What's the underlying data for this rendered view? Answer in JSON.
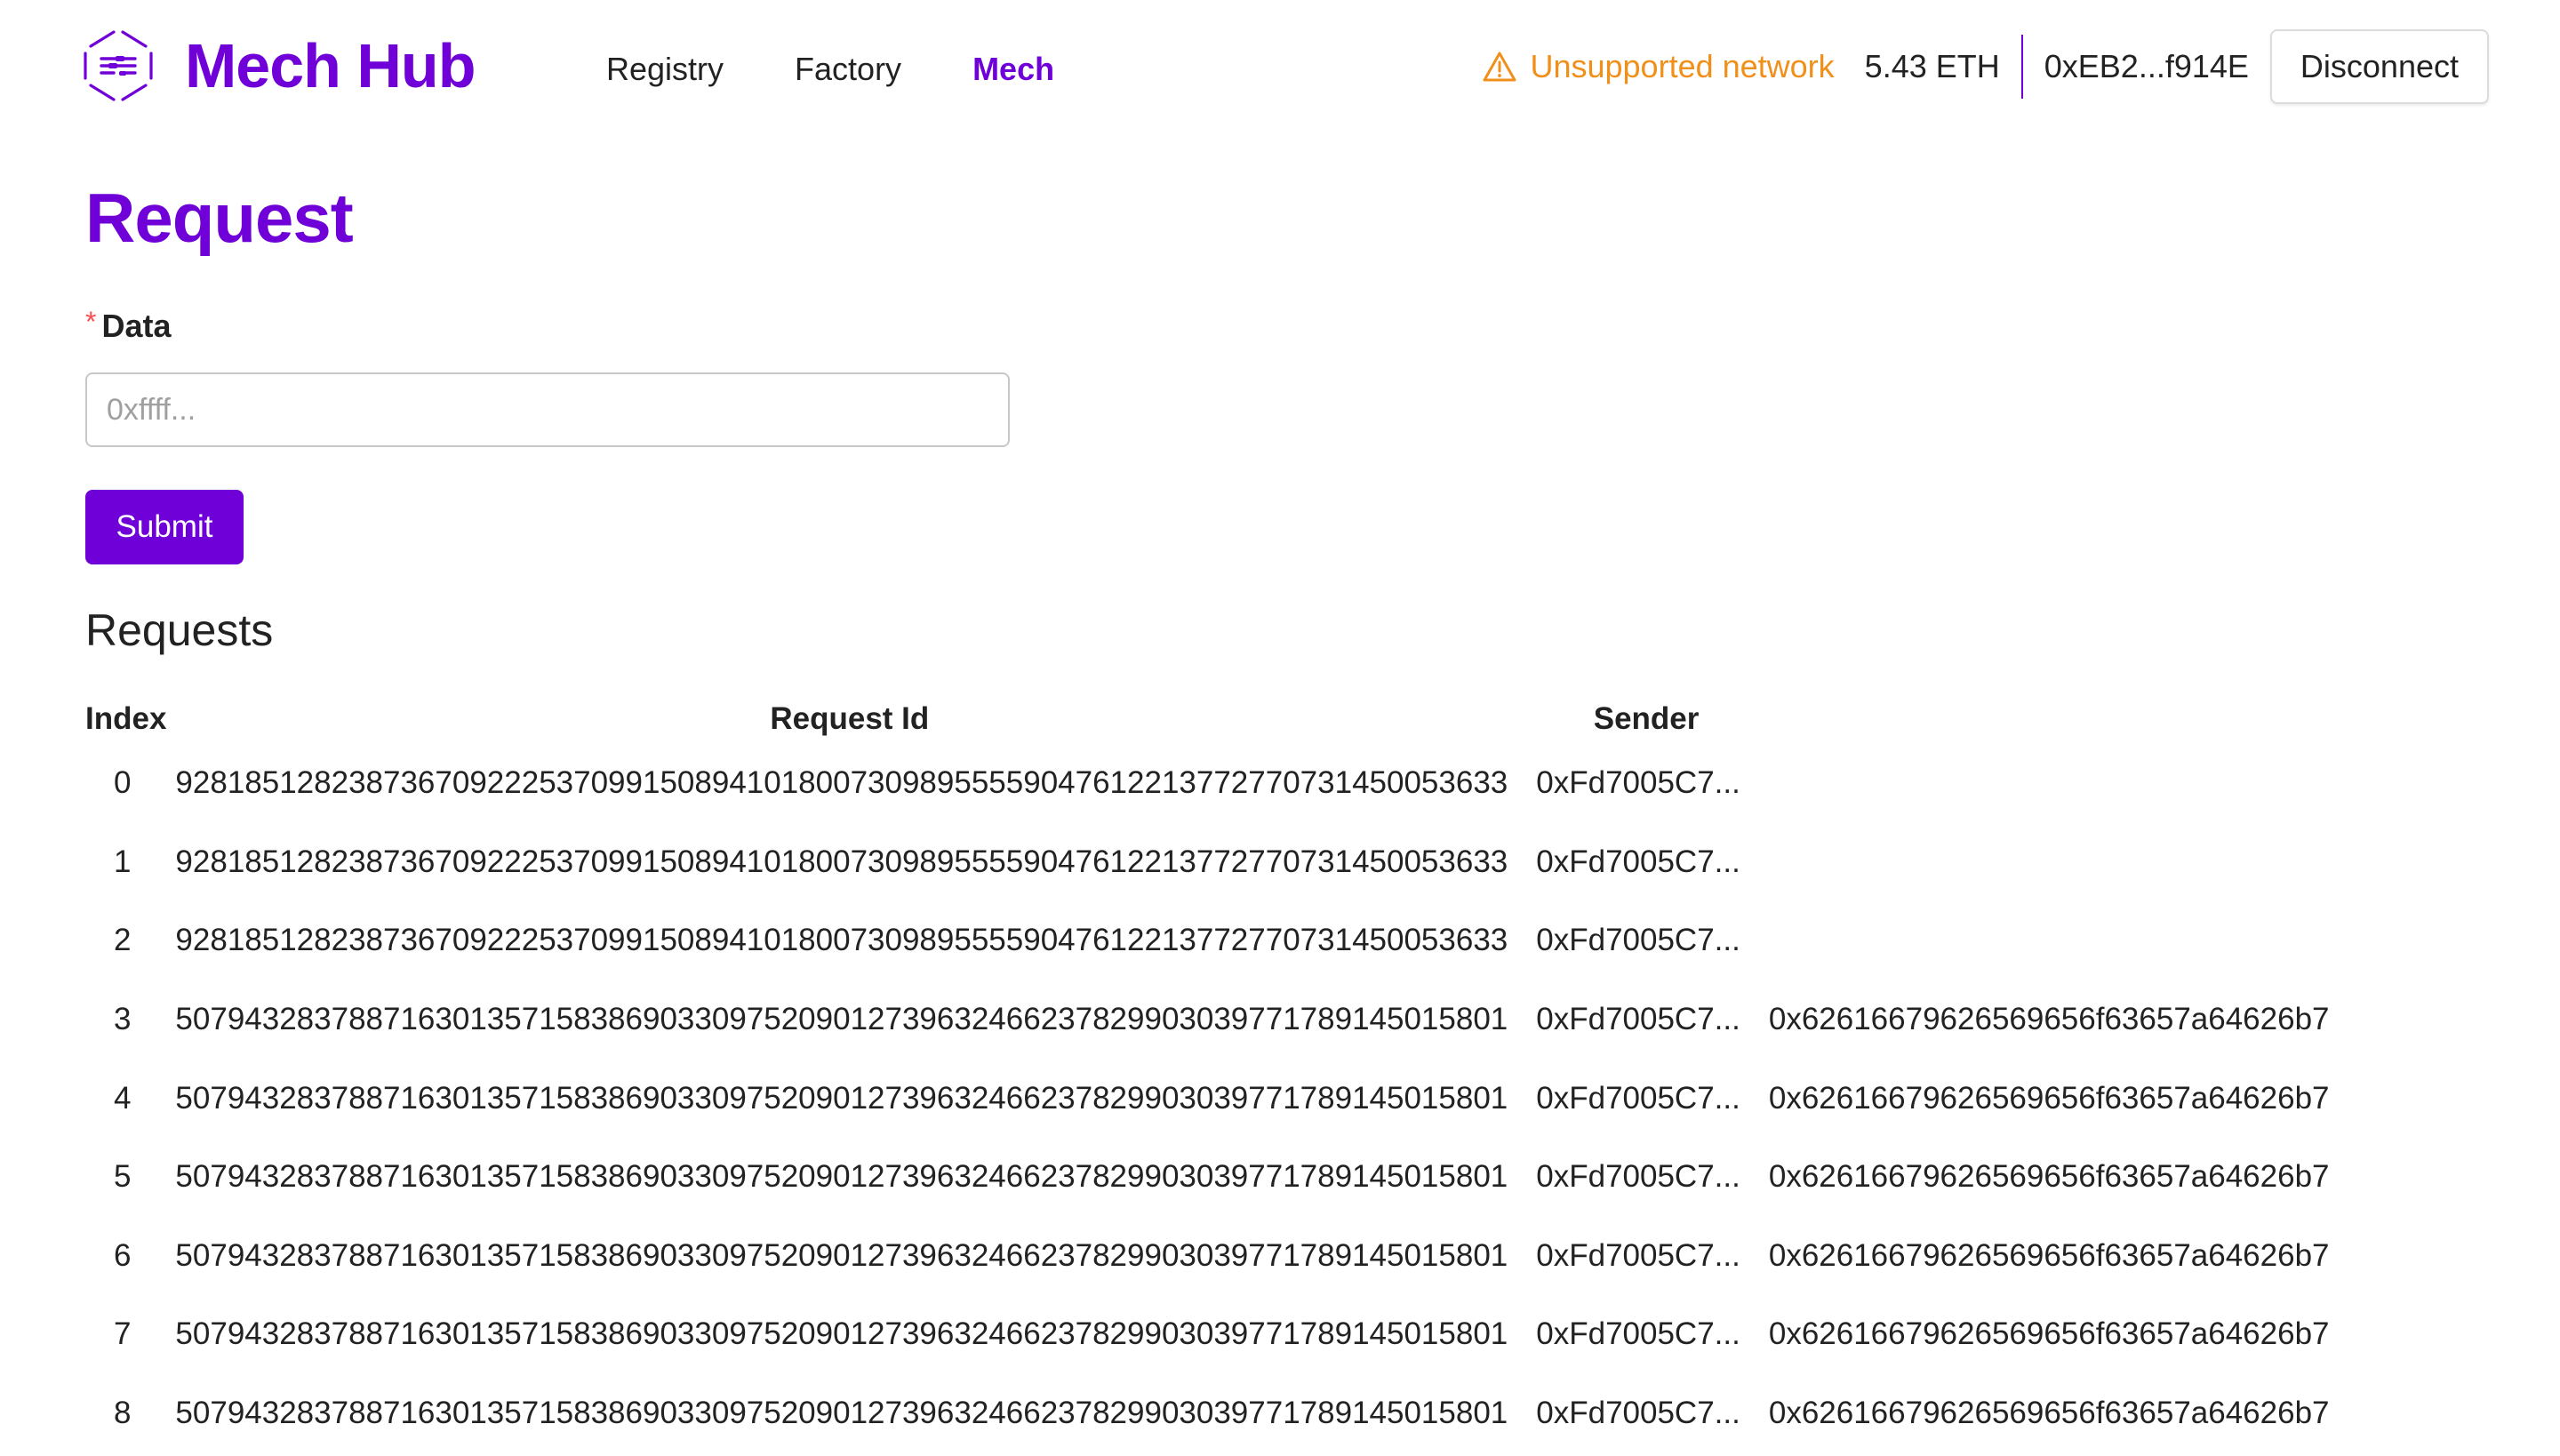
{
  "header": {
    "brand": "Mech Hub",
    "nav": [
      {
        "label": "Registry",
        "active": false
      },
      {
        "label": "Factory",
        "active": false
      },
      {
        "label": "Mech",
        "active": true
      }
    ],
    "network_warning": "Unsupported network",
    "balance": "5.43 ETH",
    "address": "0xEB2...f914E",
    "disconnect_label": "Disconnect"
  },
  "colors": {
    "brand": "#7000d8",
    "warning": "#f0901a",
    "required": "#ff4d4f"
  },
  "form": {
    "title": "Request",
    "required_marker": "*",
    "field_label": "Data",
    "field_placeholder": "0xffff...",
    "field_value": "",
    "submit_label": "Submit"
  },
  "requests": {
    "title": "Requests",
    "columns": [
      "Index",
      "Request Id",
      "Sender",
      ""
    ],
    "rows": [
      {
        "index": "0",
        "request_id": "92818512823873670922253709915089410180073098955559047612213772770731450053633",
        "sender": "0xFd7005C7...",
        "data": ""
      },
      {
        "index": "1",
        "request_id": "92818512823873670922253709915089410180073098955559047612213772770731450053633",
        "sender": "0xFd7005C7...",
        "data": ""
      },
      {
        "index": "2",
        "request_id": "92818512823873670922253709915089410180073098955559047612213772770731450053633",
        "sender": "0xFd7005C7...",
        "data": ""
      },
      {
        "index": "3",
        "request_id": "50794328378871630135715838690330975209012739632466237829903039771789145015801",
        "sender": "0xFd7005C7...",
        "data": "0x62616679626569656f63657a64626b7"
      },
      {
        "index": "4",
        "request_id": "50794328378871630135715838690330975209012739632466237829903039771789145015801",
        "sender": "0xFd7005C7...",
        "data": "0x62616679626569656f63657a64626b7"
      },
      {
        "index": "5",
        "request_id": "50794328378871630135715838690330975209012739632466237829903039771789145015801",
        "sender": "0xFd7005C7...",
        "data": "0x62616679626569656f63657a64626b7"
      },
      {
        "index": "6",
        "request_id": "50794328378871630135715838690330975209012739632466237829903039771789145015801",
        "sender": "0xFd7005C7...",
        "data": "0x62616679626569656f63657a64626b7"
      },
      {
        "index": "7",
        "request_id": "50794328378871630135715838690330975209012739632466237829903039771789145015801",
        "sender": "0xFd7005C7...",
        "data": "0x62616679626569656f63657a64626b7"
      },
      {
        "index": "8",
        "request_id": "50794328378871630135715838690330975209012739632466237829903039771789145015801",
        "sender": "0xFd7005C7...",
        "data": "0x62616679626569656f63657a64626b7"
      }
    ]
  }
}
